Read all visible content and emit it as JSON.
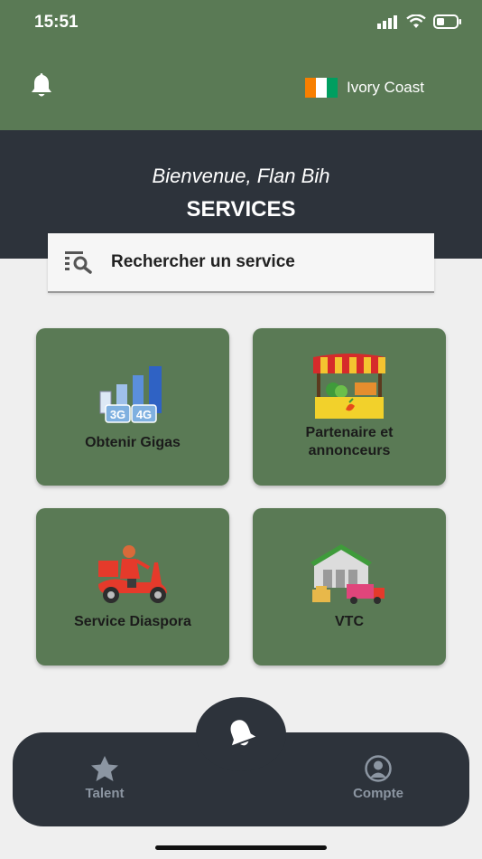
{
  "status_bar": {
    "time": "15:51"
  },
  "top_bar": {
    "country": "Ivory Coast"
  },
  "header": {
    "welcome": "Bienvenue, Flan Bih",
    "title": "SERVICES"
  },
  "search": {
    "placeholder": "Rechercher un service"
  },
  "services": [
    {
      "label": "Obtenir Gigas",
      "icon": "signal-bars-3g-4g-icon",
      "badge_3g": "3G",
      "badge_4g": "4G"
    },
    {
      "label": "Partenaire et\nannonceurs",
      "line1": "Partenaire et",
      "line2": "annonceurs",
      "icon": "market-stall-icon"
    },
    {
      "label": "Service Diaspora",
      "icon": "delivery-scooter-icon"
    },
    {
      "label": "VTC",
      "icon": "warehouse-truck-icon"
    }
  ],
  "bottom_nav": {
    "items": [
      {
        "label": "Talent",
        "icon": "star-icon"
      },
      {
        "label": "Compte",
        "icon": "user-icon"
      }
    ],
    "center_icon": "bell-icon"
  },
  "colors": {
    "green": "#5a7a55",
    "dark": "#2d333b",
    "background": "#efefef"
  }
}
